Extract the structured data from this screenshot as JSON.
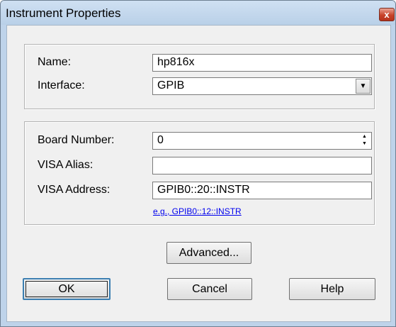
{
  "window": {
    "title": "Instrument Properties",
    "close_glyph": "x"
  },
  "general": {
    "name_label": "Name:",
    "name_value": "hp816x",
    "interface_label": "Interface:",
    "interface_value": "GPIB"
  },
  "connection": {
    "board_label": "Board Number:",
    "board_value": "0",
    "alias_label": "VISA Alias:",
    "alias_value": "",
    "address_label": "VISA Address:",
    "address_value": "GPIB0::20::INSTR",
    "example_link": "e.g., GPIB0::12::INSTR"
  },
  "buttons": {
    "advanced": "Advanced...",
    "ok": "OK",
    "cancel": "Cancel",
    "help": "Help"
  },
  "icons": {
    "close": "close-icon",
    "spin_up": "spin-up-icon",
    "spin_down": "spin-down-icon",
    "dropdown": "chevron-down-icon"
  }
}
